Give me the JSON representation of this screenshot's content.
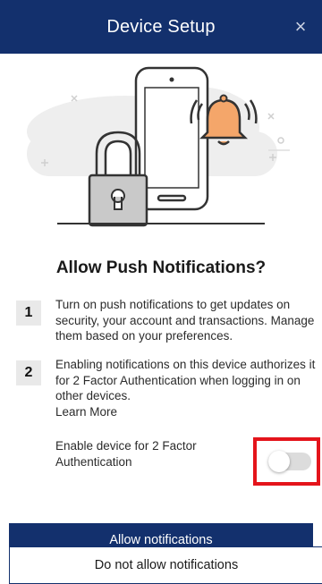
{
  "header": {
    "title": "Device Setup",
    "close_glyph": "×",
    "background": "#13306d"
  },
  "illustration": {
    "icons": [
      "phone-icon",
      "padlock-icon",
      "bell-icon"
    ],
    "bell_color": "#f4a66a"
  },
  "main": {
    "title": "Allow Push Notifications?",
    "steps": [
      {
        "number": "1",
        "text": "Turn on push notifications to get updates on security, your account and transactions. Manage them based on your preferences."
      },
      {
        "number": "2",
        "text": "Enabling notifications on this device authorizes it for 2 Factor Authentication when logging in on other devices.",
        "link": "Learn More"
      }
    ],
    "toggle": {
      "label": "Enable device for 2 Factor Authentication",
      "state": "off",
      "highlight_color": "#e4141b"
    }
  },
  "buttons": {
    "allow_label": "Allow notifications",
    "deny_label": "Do not allow notifications"
  }
}
